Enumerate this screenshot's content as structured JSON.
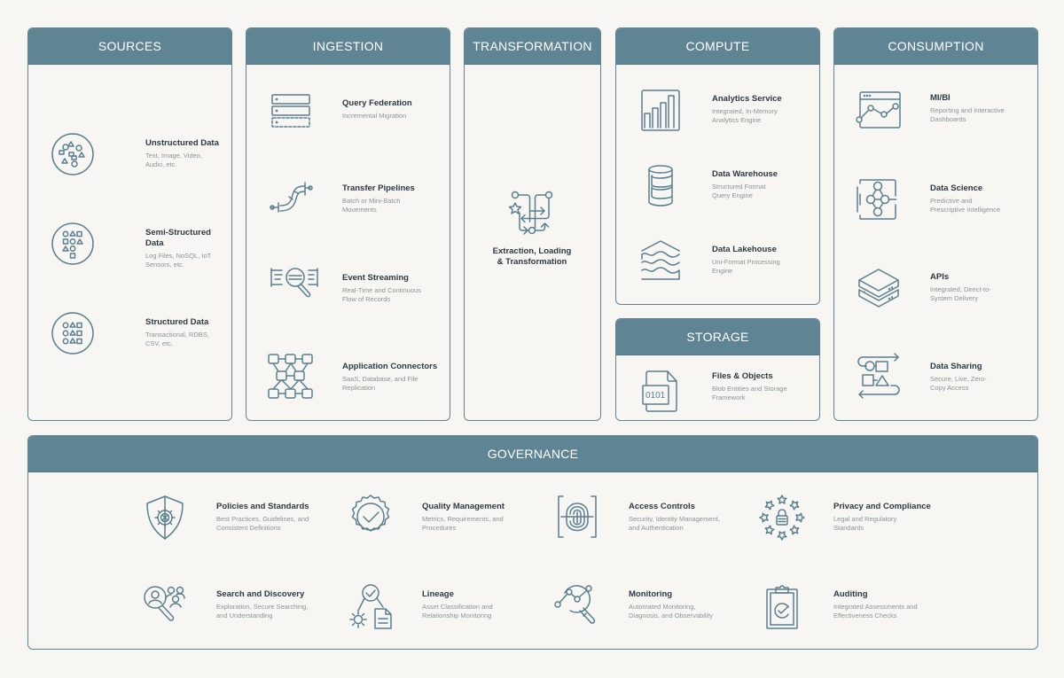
{
  "colors": {
    "header": "#5f8595",
    "border": "#5f8595",
    "background": "#f7f6f2",
    "icon": "#5a7f8f",
    "title": "#2c3a44",
    "desc": "#8a949a"
  },
  "sources": {
    "header": "SOURCES",
    "items": [
      {
        "icon": "unstructured-data-icon",
        "title": "Unstructured Data",
        "desc1": "Text, Image, Video,",
        "desc2": "Audio, etc."
      },
      {
        "icon": "semi-structured-data-icon",
        "title": "Semi-Structured Data",
        "desc1": "Log Files, NoSQL, IoT",
        "desc2": "Sensors, etc."
      },
      {
        "icon": "structured-data-icon",
        "title": "Structured Data",
        "desc1": "Transactional, RDBS,",
        "desc2": "CSV, etc."
      }
    ]
  },
  "ingestion": {
    "header": "INGESTION",
    "items": [
      {
        "icon": "server-stack-icon",
        "title": "Query Federation",
        "desc1": "Incremental Migration",
        "desc2": ""
      },
      {
        "icon": "pipeline-icon",
        "title": "Transfer Pipelines",
        "desc1": "Batch or Mini-Batch",
        "desc2": "Movements"
      },
      {
        "icon": "stream-search-icon",
        "title": "Event Streaming",
        "desc1": "Real-Time and Continuous",
        "desc2": "Flow of Records"
      },
      {
        "icon": "connector-network-icon",
        "title": "Application Connectors",
        "desc1": "SaaS, Database, and File",
        "desc2": "Replication"
      }
    ]
  },
  "transformation": {
    "header": "TRANSFORMATION",
    "item": {
      "icon": "elt-flow-icon",
      "title1": "Extraction, Loading",
      "title2": "& Transformation"
    }
  },
  "compute": {
    "header": "COMPUTE",
    "items": [
      {
        "icon": "bar-chart-icon",
        "title": "Analytics Service",
        "desc1": "Integrated, In-Memory",
        "desc2": "Analytics Engine"
      },
      {
        "icon": "database-icon",
        "title": "Data Warehouse",
        "desc1": "Structured Format",
        "desc2": "Query Engine"
      },
      {
        "icon": "lakehouse-icon",
        "title": "Data Lakehouse",
        "desc1": "Uni-Format Processing",
        "desc2": "Engine"
      }
    ]
  },
  "storage": {
    "header": "STORAGE",
    "item": {
      "icon": "binary-file-icon",
      "title": "Files & Objects",
      "desc1": "Blob Entities and Storage",
      "desc2": "Framework",
      "file_text": "0101"
    }
  },
  "consumption": {
    "header": "CONSUMPTION",
    "items": [
      {
        "icon": "dashboard-chart-icon",
        "title": "MI/BI",
        "desc1": "Reporting and Interactive",
        "desc2": "Dashboards"
      },
      {
        "icon": "data-science-icon",
        "title": "Data Science",
        "desc1": "Predictive and",
        "desc2": "Prescriptive Intelligence"
      },
      {
        "icon": "api-layers-icon",
        "title": "APIs",
        "desc1": "Integrated, Direct-to-",
        "desc2": "System Delivery"
      },
      {
        "icon": "data-sharing-icon",
        "title": "Data Sharing",
        "desc1": "Secure, Live, Zero-",
        "desc2": "Copy Access"
      }
    ]
  },
  "governance": {
    "header": "GOVERNANCE",
    "items": [
      {
        "icon": "shield-icon",
        "title": "Policies and Standards",
        "desc1": "Best Practices, Guidelines, and",
        "desc2": "Consistent Definitions"
      },
      {
        "icon": "quality-badge-icon",
        "title": "Quality Management",
        "desc1": "Metrics, Requirements, and",
        "desc2": "Procedures"
      },
      {
        "icon": "fingerprint-icon",
        "title": "Access Controls",
        "desc1": "Security, Identity Management,",
        "desc2": "and Authentication"
      },
      {
        "icon": "privacy-stars-lock-icon",
        "title": "Privacy and Compliance",
        "desc1": "Legal and Regulatory",
        "desc2": "Standards"
      },
      {
        "icon": "people-search-icon",
        "title": "Search and Discovery",
        "desc1": "Exploration, Secure Searching,",
        "desc2": "and Understanding"
      },
      {
        "icon": "lineage-icon",
        "title": "Lineage",
        "desc1": "Asset Classification and",
        "desc2": "Relationship Monitoring"
      },
      {
        "icon": "monitoring-search-icon",
        "title": "Monitoring",
        "desc1": "Automated Monitoring,",
        "desc2": "Diagnosis, and Observability"
      },
      {
        "icon": "clipboard-check-icon",
        "title": "Auditing",
        "desc1": "Integrated Assessments and",
        "desc2": "Effectiveness Checks"
      }
    ]
  }
}
